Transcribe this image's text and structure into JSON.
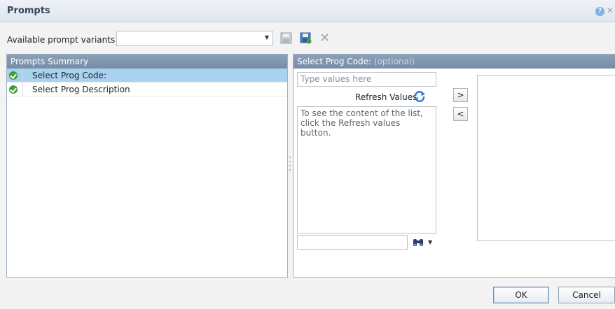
{
  "dialog": {
    "title": "Prompts",
    "help_glyph": "?",
    "close_glyph": "✕"
  },
  "variants": {
    "label": "Available prompt variants",
    "selected_value": "",
    "arrow_glyph": "▼",
    "delete_glyph": "✕"
  },
  "summary": {
    "header": "Prompts Summary",
    "items": [
      {
        "label": "Select Prog Code:",
        "status": "answered",
        "selected": true
      },
      {
        "label": "Select Prog Description",
        "status": "answered",
        "selected": false
      }
    ]
  },
  "prompt": {
    "header_label": "Select Prog Code:",
    "header_optional": "(optional)",
    "input_placeholder": "Type values here",
    "refresh_label": "Refresh Values",
    "list_hint": "To see the content of the list, click the Refresh values button.",
    "move_right": ">",
    "move_left": "<",
    "search_arrow": "▼"
  },
  "buttons": {
    "ok": "OK",
    "cancel": "Cancel"
  },
  "colors": {
    "header_bg": "#758da5",
    "selected_row": "#a8d2f0",
    "check_green": "#3f9e35"
  }
}
